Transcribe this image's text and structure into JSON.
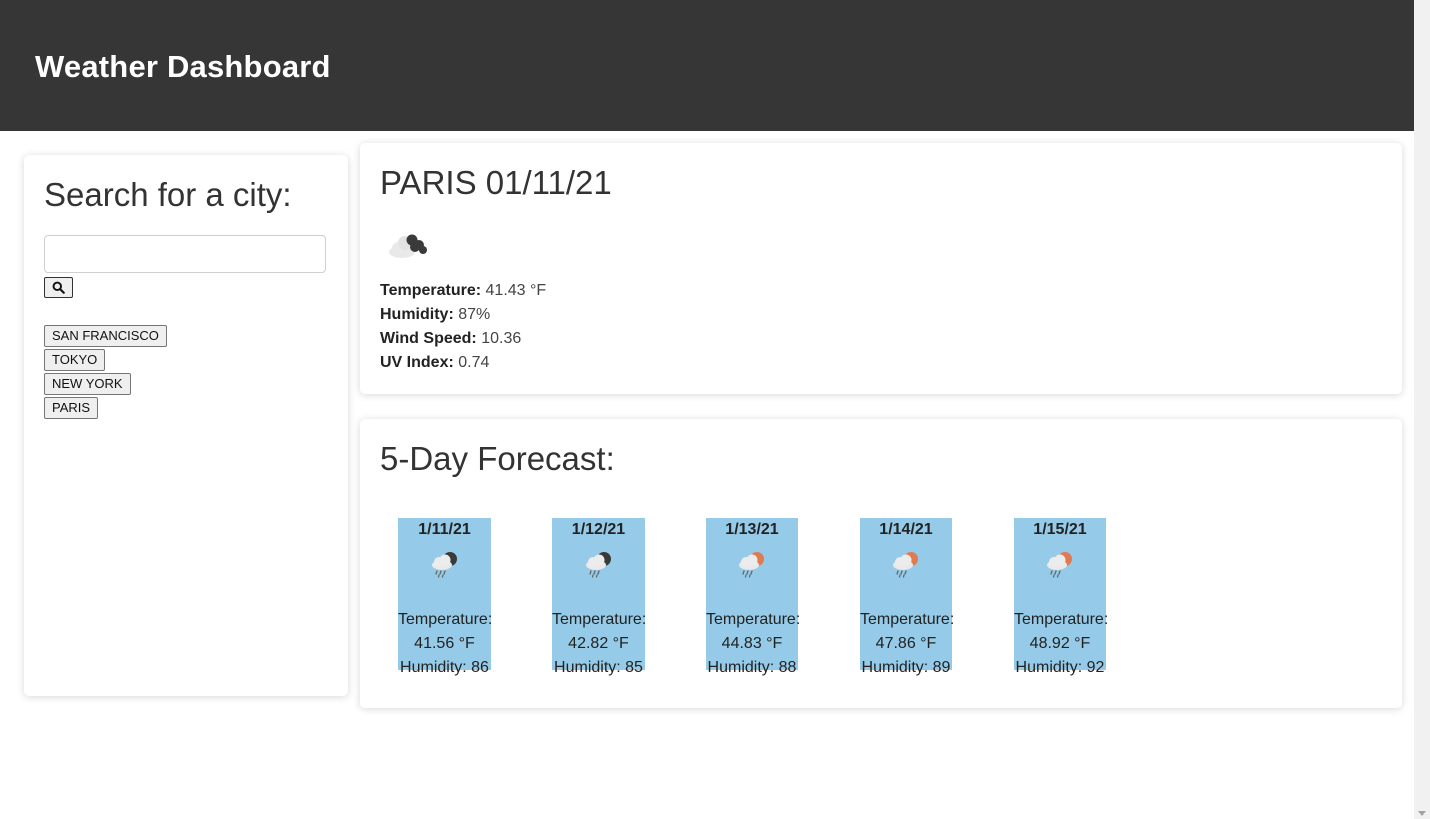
{
  "header": {
    "title": "Weather Dashboard"
  },
  "search": {
    "heading": "Search for a city:",
    "input_value": "",
    "input_placeholder": "",
    "button_icon": "search-icon"
  },
  "history": [
    "SAN FRANCISCO",
    "TOKYO",
    "NEW YORK",
    "PARIS"
  ],
  "current": {
    "heading": "PARIS 01/11/21",
    "icon": "broken-clouds-icon",
    "temperature_label": "Temperature:",
    "temperature_value": "41.43 °F",
    "humidity_label": "Humidity:",
    "humidity_value": "87%",
    "wind_label": "Wind Speed:",
    "wind_value": "10.36",
    "uv_label": "UV Index:",
    "uv_value": "0.74"
  },
  "forecast": {
    "heading": "5-Day Forecast:",
    "days": [
      {
        "date": "1/11/21",
        "icon": "rain-night-icon",
        "temp_label": "Temperature:",
        "temp": "41.56 °F",
        "humidity": "Humidity: 86"
      },
      {
        "date": "1/12/21",
        "icon": "rain-night-icon",
        "temp_label": "Temperature:",
        "temp": "42.82 °F",
        "humidity": "Humidity: 85"
      },
      {
        "date": "1/13/21",
        "icon": "rain-day-icon",
        "temp_label": "Temperature:",
        "temp": "44.83 °F",
        "humidity": "Humidity: 88"
      },
      {
        "date": "1/14/21",
        "icon": "rain-day-icon",
        "temp_label": "Temperature:",
        "temp": "47.86 °F",
        "humidity": "Humidity: 89"
      },
      {
        "date": "1/15/21",
        "icon": "rain-day-icon",
        "temp_label": "Temperature:",
        "temp": "48.92 °F",
        "humidity": "Humidity: 92"
      }
    ]
  },
  "colors": {
    "header_bg": "#363636",
    "forecast_tile": "#95cbe8",
    "sun": "#e07a4f",
    "moon": "#3a3a3a"
  }
}
